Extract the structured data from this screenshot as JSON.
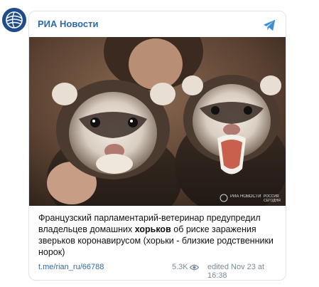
{
  "post": {
    "channel_name": "РИА Новости",
    "text_before": "Французский парламентарий-ветеринар предупредил владельцев домашних ",
    "text_bold": "хорьков",
    "text_after": " об риске заражения зверьков коронавирусом (хорьки - близкие родственники норок)",
    "link": "t.me/rian_ru/66788",
    "views": "5.3K",
    "edited": "edited  Nov 23 at 16:38",
    "photo_watermark_1": "РИА НОВОСТИ",
    "photo_watermark_2": "РОССИЯ СЕГОДНЯ"
  },
  "icons": {
    "avatar": "ria-logo-icon",
    "share": "telegram-plane-icon",
    "views": "eye-icon"
  },
  "colors": {
    "link": "#2a6aa8",
    "avatar_bg": "#1f4d8c",
    "meta_text": "#7a8894"
  }
}
